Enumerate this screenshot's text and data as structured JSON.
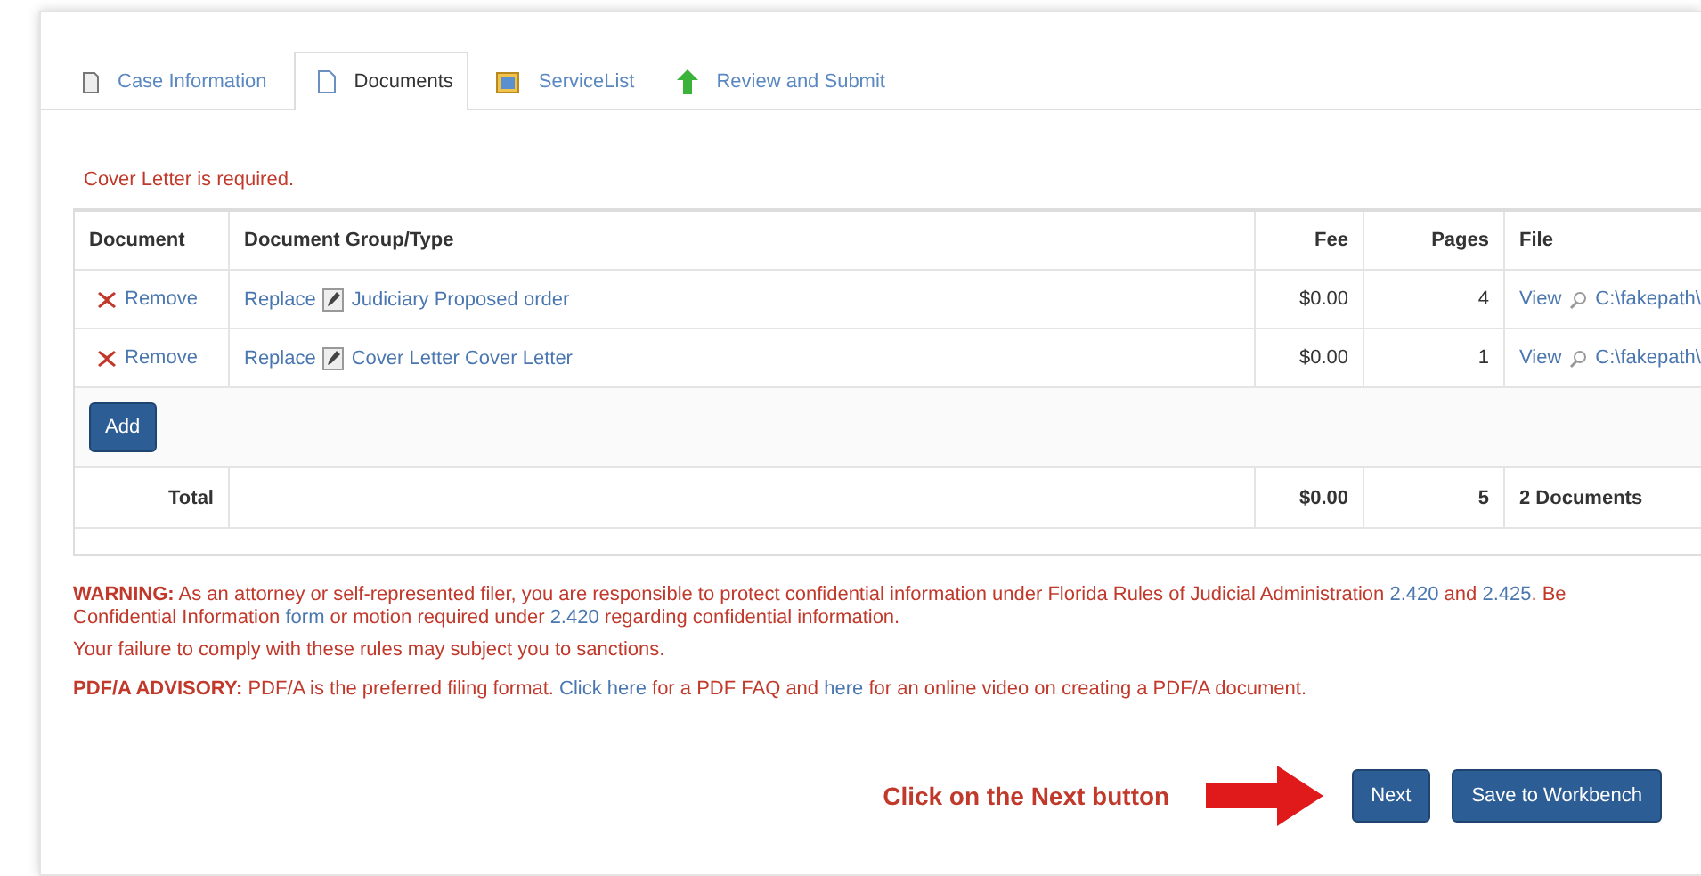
{
  "tabs": [
    {
      "label": "Case Information",
      "selected": false
    },
    {
      "label": "Documents",
      "selected": true
    },
    {
      "label": "ServiceList",
      "selected": false
    },
    {
      "label": "Review and Submit",
      "selected": false
    }
  ],
  "error": "Cover Letter is required.",
  "table": {
    "columns": [
      "Document",
      "Document Group/Type",
      "Fee",
      "Pages",
      "File"
    ],
    "rows": [
      {
        "remove": "Remove",
        "replace": "Replace",
        "type": "Judiciary Proposed order",
        "fee": "$0.00",
        "pages": "4",
        "view": "View",
        "file": "C:\\fakepath\\"
      },
      {
        "remove": "Remove",
        "replace": "Replace",
        "type": "Cover Letter Cover Letter",
        "fee": "$0.00",
        "pages": "1",
        "view": "View",
        "file": "C:\\fakepath\\"
      }
    ],
    "add_button": "Add",
    "total": {
      "label": "Total",
      "fee": "$0.00",
      "pages": "5",
      "file": "2 Documents"
    }
  },
  "notices": [
    {
      "kind": "warning",
      "segments": [
        {
          "kind": "text",
          "text": "**WARNING:** As an attorney or self-represented filer, you are responsible to protect confidential information under Florida Rules of Judicial Administration "
        },
        {
          "kind": "link",
          "text": "2.420"
        },
        {
          "kind": "text",
          "text": " and "
        },
        {
          "kind": "link",
          "text": "2.425"
        },
        {
          "kind": "text",
          "text": ". Be"
        },
        {
          "kind": "break"
        },
        {
          "kind": "text",
          "text": "Confidential Information "
        },
        {
          "kind": "link",
          "text": "form"
        },
        {
          "kind": "text",
          "text": " or motion required under "
        },
        {
          "kind": "link",
          "text": "2.420"
        },
        {
          "kind": "text",
          "text": " regarding confidential information."
        }
      ]
    },
    {
      "kind": "plain",
      "segments": [
        {
          "kind": "text",
          "text": "Your failure to comply with these rules may subject you to sanctions."
        }
      ]
    },
    {
      "kind": "advisory",
      "segments": [
        {
          "kind": "text",
          "text": "**PDF/A ADVISORY:** PDF/A is the preferred filing format. "
        },
        {
          "kind": "link",
          "text": "Click here"
        },
        {
          "kind": "text",
          "text": " for a PDF FAQ and "
        },
        {
          "kind": "link",
          "text": "here"
        },
        {
          "kind": "text",
          "text": " for an online video on creating a PDF/A document."
        }
      ]
    }
  ],
  "callout": "Click on the Next button",
  "buttons": [
    "Next",
    "Save to Workbench"
  ]
}
